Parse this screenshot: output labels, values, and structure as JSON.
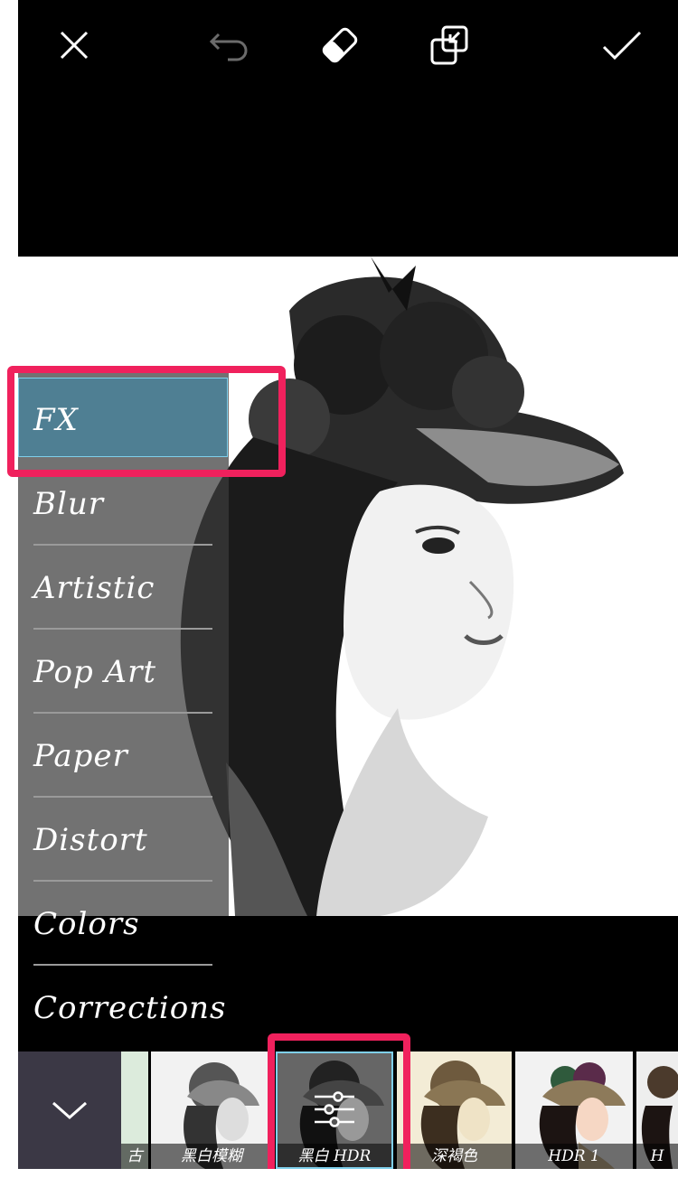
{
  "toolbar": {
    "close_icon": "close-icon",
    "undo_icon": "undo-icon",
    "eraser_icon": "eraser-icon",
    "compare_icon": "compare-icon",
    "apply_icon": "checkmark-icon"
  },
  "menu": {
    "items": [
      {
        "label": "FX"
      },
      {
        "label": "Blur"
      },
      {
        "label": "Artistic"
      },
      {
        "label": "Pop Art"
      },
      {
        "label": "Paper"
      },
      {
        "label": "Distort"
      },
      {
        "label": "Colors"
      },
      {
        "label": "Corrections"
      }
    ],
    "selected": "FX"
  },
  "filters": {
    "items": [
      {
        "caption": "古"
      },
      {
        "caption": "黑白模糊"
      },
      {
        "caption": "黑白 HDR"
      },
      {
        "caption": "深褐色"
      },
      {
        "caption": "HDR 1"
      },
      {
        "caption": "H"
      }
    ],
    "selected": "黑白 HDR",
    "settings_icon": "sliders-icon",
    "collapse_icon": "chevron-down-icon"
  },
  "colors": {
    "highlight": "#f0215d",
    "fx_active_bg": "#4f7f93",
    "selected_border": "#7fd0ec"
  }
}
